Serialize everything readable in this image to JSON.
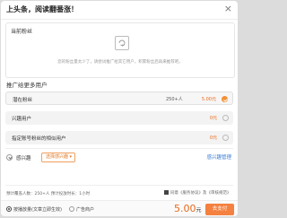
{
  "dialog": {
    "title": "上头条，阅读翻番涨！",
    "close_glyph": "×"
  },
  "current": {
    "label": "当前粉丝",
    "empty_text": "您的粉丝量太少了，请尝试推广给其它用户，积累粉丝后再来推荐吧。"
  },
  "promotion": {
    "section_title": "推广给更多用户",
    "options": [
      {
        "label": "潜在粉丝",
        "reach": "250+人",
        "price": "5.00元",
        "selected": true
      },
      {
        "label": "兴趣用户",
        "reach": "",
        "price": "0元",
        "selected": false
      },
      {
        "label": "指定账号粉丝的相似用户",
        "reach": "",
        "price": "0元",
        "selected": false
      }
    ]
  },
  "interest": {
    "label": "感兴趣",
    "button_label": "选择感兴趣",
    "caret": "▾",
    "manage_link": "感兴趣管理"
  },
  "estimate_text": "预计覆盖人数：250+人   预计投放时长：1小时",
  "agree_text": "同意《服务协议》及《审核规范》",
  "footer": {
    "radio_1": "按播放量(文章立即生效)",
    "radio_2": "广告商户",
    "total_value": "5.00",
    "total_unit": "元",
    "pay_button": "去支付"
  },
  "colors": {
    "accent": "#f4813f",
    "price": "#e86a1a",
    "link": "#3a7bd5"
  }
}
